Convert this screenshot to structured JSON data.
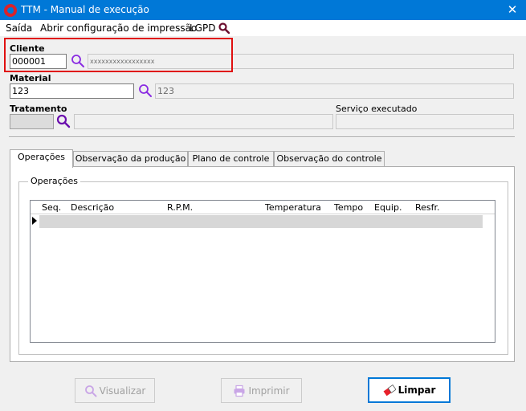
{
  "window": {
    "title": "TTM - Manual de execução",
    "close_glyph": "✕"
  },
  "menu": {
    "items": [
      "Saída",
      "Abrir configuração de impressão",
      "LGPD"
    ],
    "search_icon": "search-icon"
  },
  "cliente": {
    "label": "Cliente",
    "code": "000001",
    "name": "xxxxxxxxxxxxxxxxx"
  },
  "material": {
    "label": "Material",
    "code": "123",
    "name": "123"
  },
  "tratamento": {
    "label": "Tratamento",
    "code": "",
    "name": ""
  },
  "servico": {
    "label": "Serviço executado",
    "value": ""
  },
  "tabs": [
    {
      "label": "Operações",
      "active": true
    },
    {
      "label": "Observação da produção",
      "active": false
    },
    {
      "label": "Plano de controle",
      "active": false
    },
    {
      "label": "Observação do controle",
      "active": false
    }
  ],
  "operacoes": {
    "group_title": "Operações",
    "columns": [
      "Seq.",
      "Descrição",
      "R.P.M.",
      "Temperatura",
      "Tempo",
      "Equip.",
      "Resfr."
    ]
  },
  "buttons": {
    "visualizar": "Visualizar",
    "imprimir": "Imprimir",
    "limpar": "Limpar"
  },
  "colors": {
    "titlebar": "#0078d7",
    "highlight": "#e01010",
    "lookup_icon": "#8a2be2",
    "accent": "#0078d7"
  }
}
